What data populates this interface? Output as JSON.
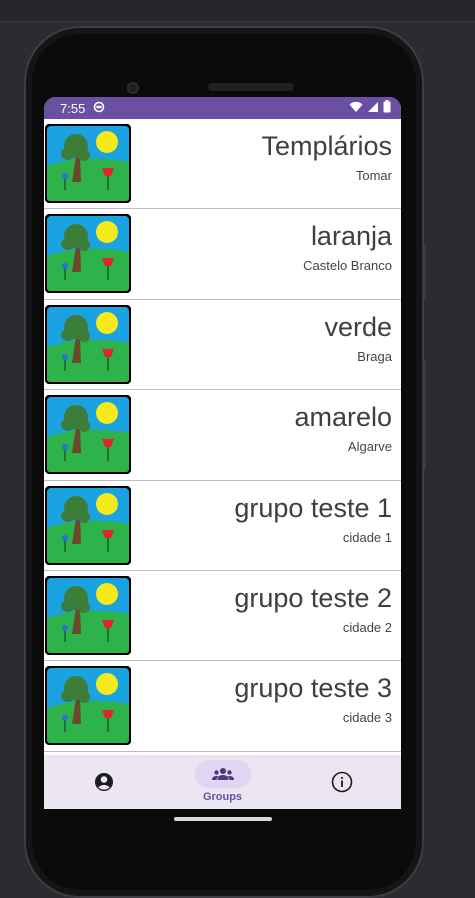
{
  "status_bar": {
    "time": "7:55"
  },
  "groups": [
    {
      "name": "Templários",
      "city": "Tomar"
    },
    {
      "name": "laranja",
      "city": "Castelo Branco"
    },
    {
      "name": "verde",
      "city": "Braga"
    },
    {
      "name": "amarelo",
      "city": "Algarve"
    },
    {
      "name": "grupo teste 1",
      "city": "cidade 1"
    },
    {
      "name": "grupo teste 2",
      "city": "cidade 2"
    },
    {
      "name": "grupo teste 3",
      "city": "cidade 3"
    }
  ],
  "bottom_nav": [
    {
      "icon": "account-circle-icon",
      "label": "",
      "active": false
    },
    {
      "icon": "groups-icon",
      "label": "Groups",
      "active": true
    },
    {
      "icon": "info-icon",
      "label": "",
      "active": false
    }
  ],
  "colors": {
    "accent": "#6a4fa3",
    "nav_background": "#ece6f3",
    "sky": "#1aa3e0",
    "grass": "#2eb24a",
    "sun": "#f7ea1b"
  }
}
